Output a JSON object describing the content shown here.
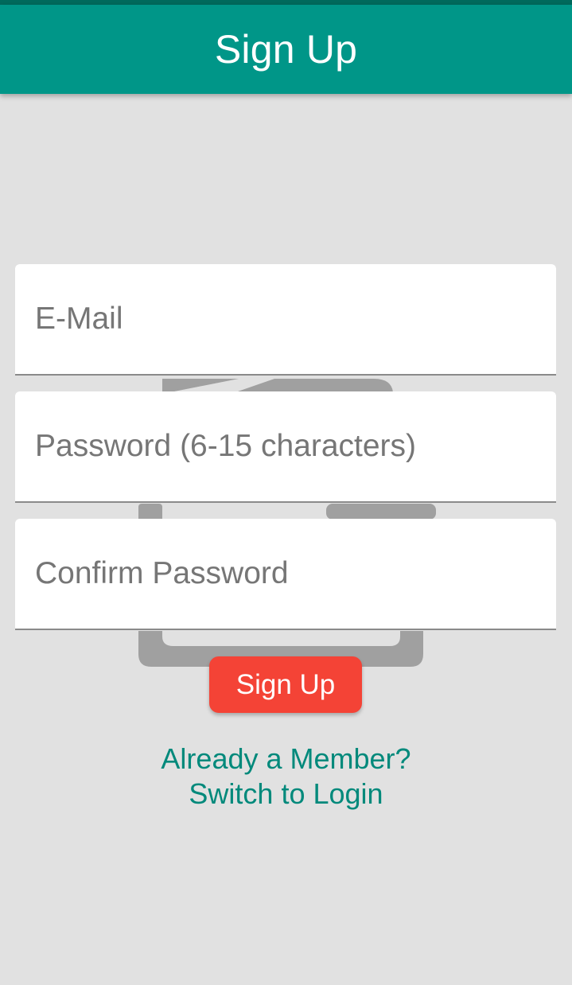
{
  "app_bar": {
    "title": "Sign Up"
  },
  "form": {
    "email": {
      "placeholder": "E-Mail",
      "value": ""
    },
    "password": {
      "placeholder": "Password (6-15 characters)",
      "value": ""
    },
    "confirm_password": {
      "placeholder": "Confirm Password",
      "value": ""
    },
    "submit_label": "Sign Up"
  },
  "switch_link": {
    "line1": "Already a Member?",
    "line2": "Switch to Login"
  },
  "colors": {
    "primary": "#009688",
    "primary_dark": "#00695c",
    "accent": "#f44336",
    "link": "#00897b",
    "background": "#e1e1e1"
  },
  "icons": {
    "background_illustration": "laptop-illustration"
  }
}
